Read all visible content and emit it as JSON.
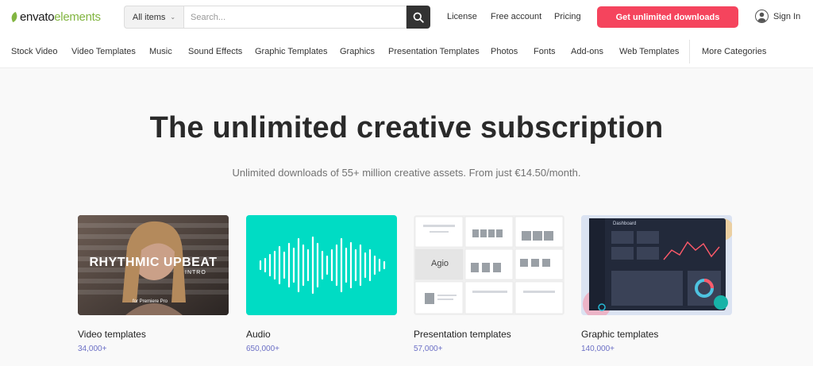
{
  "header": {
    "logo_part1": "envato",
    "logo_part2": "elements",
    "search_category": "All items",
    "search_placeholder": "Search...",
    "links": [
      "License",
      "Free account",
      "Pricing"
    ],
    "cta": "Get unlimited downloads",
    "sign_in": "Sign In"
  },
  "categories": [
    "Stock Video",
    "Video Templates",
    "Music",
    "Sound Effects",
    "Graphic Templates",
    "Graphics",
    "Presentation Templates",
    "Photos",
    "Fonts",
    "Add-ons",
    "Web Templates",
    "More Categories"
  ],
  "hero": {
    "title": "The unlimited creative subscription",
    "subtitle": "Unlimited downloads of 55+ million creative assets. From just €14.50/month."
  },
  "cards": [
    {
      "label": "Video templates",
      "count": "34,000+",
      "thumb_text": "RHYTHMIC UPBEAT",
      "thumb_sub": "INTRO",
      "thumb_small": "for Premiere Pro"
    },
    {
      "label": "Audio",
      "count": "650,000+"
    },
    {
      "label": "Presentation templates",
      "count": "57,000+",
      "thumb_text": "Agio"
    },
    {
      "label": "Graphic templates",
      "count": "140,000+",
      "thumb_text": "Dashboard"
    }
  ],
  "colors": {
    "accent": "#f5445d",
    "brand_green": "#82b541",
    "count": "#6b6fc5",
    "audio_bg": "#00dcc4"
  }
}
